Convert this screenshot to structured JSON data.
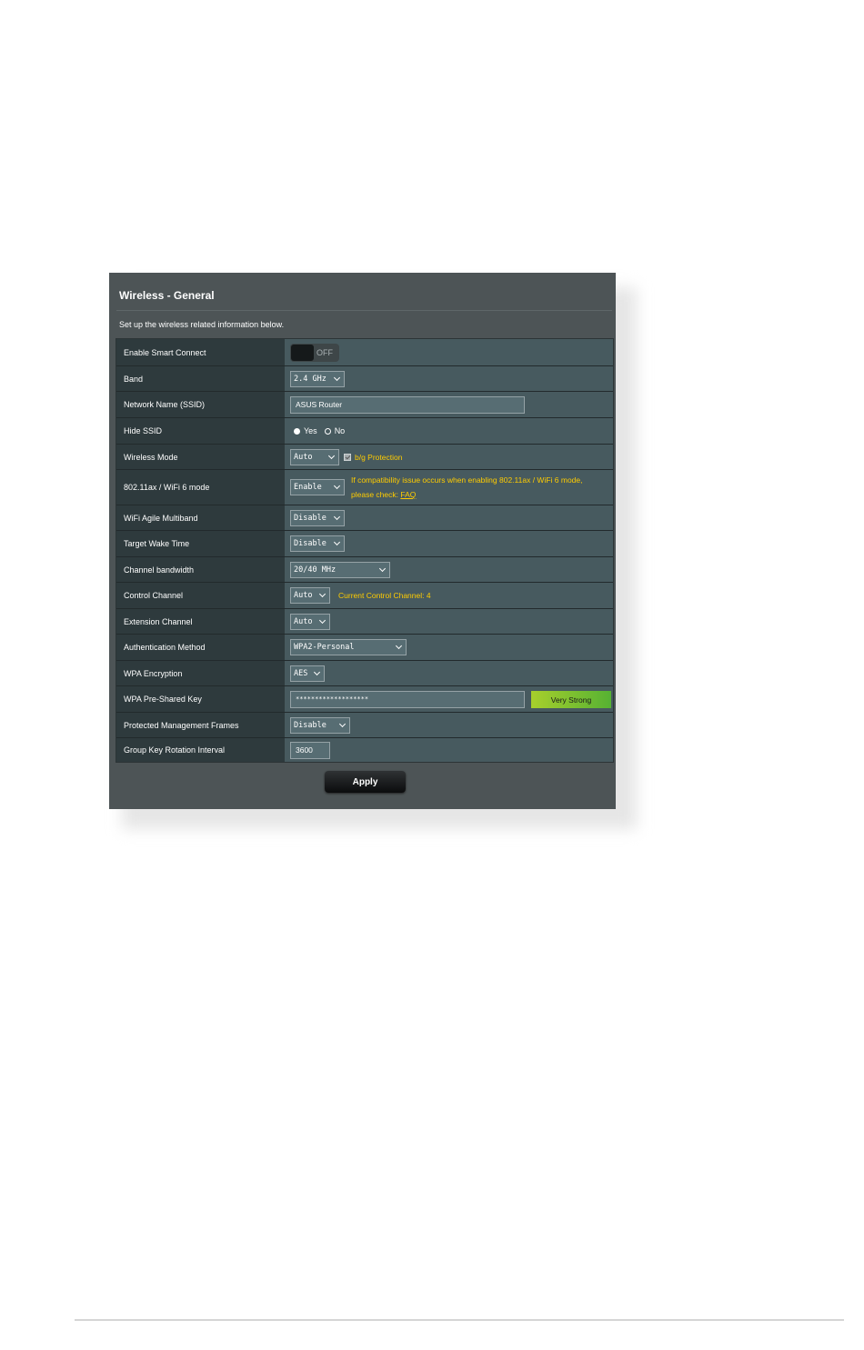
{
  "panel": {
    "title": "Wireless - General",
    "description": "Set up the wireless related information below."
  },
  "rows": {
    "smart_connect": {
      "label": "Enable Smart Connect",
      "toggle": "OFF"
    },
    "band": {
      "label": "Band",
      "value": "2.4 GHz"
    },
    "ssid": {
      "label": "Network Name (SSID)",
      "value": "ASUS Router"
    },
    "hide_ssid": {
      "label": "Hide SSID",
      "options": [
        "Yes",
        "No"
      ],
      "selected": "Yes"
    },
    "wireless_mode": {
      "label": "Wireless Mode",
      "value": "Auto",
      "checkbox_label": "b/g Protection",
      "checked": true
    },
    "wifi6_mode": {
      "label": "802.11ax / WiFi 6 mode",
      "value": "Enable",
      "note_line1": "If compatibility issue occurs when enabling 802.11ax / WiFi 6 mode,",
      "note_line2_prefix": "please check:",
      "note_link": "FAQ"
    },
    "agile_multiband": {
      "label": "WiFi Agile Multiband",
      "value": "Disable"
    },
    "target_wake_time": {
      "label": "Target Wake Time",
      "value": "Disable"
    },
    "channel_bandwidth": {
      "label": "Channel bandwidth",
      "value": "20/40 MHz"
    },
    "control_channel": {
      "label": "Control Channel",
      "value": "Auto",
      "note": "Current Control Channel: 4"
    },
    "extension_channel": {
      "label": "Extension Channel",
      "value": "Auto"
    },
    "auth_method": {
      "label": "Authentication Method",
      "value": "WPA2-Personal"
    },
    "wpa_encryption": {
      "label": "WPA Encryption",
      "value": "AES"
    },
    "psk": {
      "label": "WPA Pre-Shared Key",
      "value": "*******************",
      "strength": "Very Strong"
    },
    "pmf": {
      "label": "Protected Management Frames",
      "value": "Disable"
    },
    "gtk_interval": {
      "label": "Group Key Rotation Interval",
      "value": "3600"
    }
  },
  "apply_label": "Apply",
  "colors": {
    "panel_bg": "#4d5456",
    "label_bg": "#2e3a3d",
    "value_bg": "#475a5f",
    "note_yellow": "#ffcc00",
    "strength_green": "#7cc12e"
  }
}
